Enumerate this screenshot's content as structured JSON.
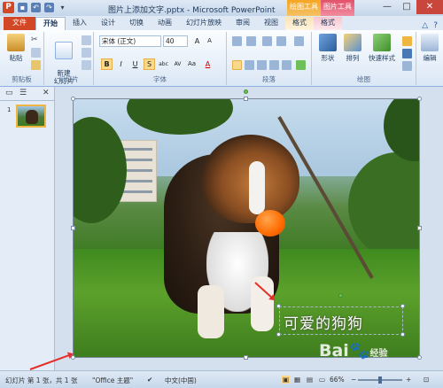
{
  "window": {
    "title": "图片上添加文字.pptx - Microsoft PowerPoint",
    "app_icon": "P",
    "context_drawing": "绘图工具",
    "context_picture": "图片工具",
    "controls": [
      "—",
      "□",
      "✕"
    ]
  },
  "tabs": [
    {
      "label": "文件",
      "kind": "file"
    },
    {
      "label": "开始",
      "kind": "active"
    },
    {
      "label": "插入"
    },
    {
      "label": "设计"
    },
    {
      "label": "切换"
    },
    {
      "label": "动画"
    },
    {
      "label": "幻灯片放映"
    },
    {
      "label": "审阅"
    },
    {
      "label": "视图"
    },
    {
      "label": "格式",
      "kind": "fmt1"
    },
    {
      "label": "格式",
      "kind": "fmt2"
    }
  ],
  "ribbon": {
    "clipboard": {
      "paste": "粘贴",
      "group": "剪贴板"
    },
    "slides": {
      "new_slide": "新建\n幻灯片",
      "group": "幻灯片"
    },
    "font": {
      "font_name": "宋体 (正文)",
      "font_size": "40",
      "bold": "B",
      "italic": "I",
      "underline": "U",
      "strike": "S",
      "shadow": "abc",
      "spacing": "AV",
      "case": "Aa",
      "color": "A",
      "grow": "A",
      "shrink": "A",
      "group": "字体"
    },
    "paragraph": {
      "group": "段落"
    },
    "drawing": {
      "shapes": "形状",
      "arrange": "排列",
      "quick_styles": "快速样式",
      "group": "绘图"
    },
    "editing": {
      "label": "编辑"
    }
  },
  "slides_pane": {
    "slide_number": "1"
  },
  "slide": {
    "caption": "可爱的狗狗"
  },
  "watermark": {
    "brand": "Bai",
    "paw": "🐾",
    "suffix": "经验"
  },
  "status": {
    "slide_info": "幻灯片 第 1 张，共 1 张",
    "theme": "\"Office 主题\"",
    "language": "中文(中国)",
    "zoom": "66%"
  },
  "colors": {
    "accent": "#d24726",
    "arrow": "#e3302b"
  }
}
